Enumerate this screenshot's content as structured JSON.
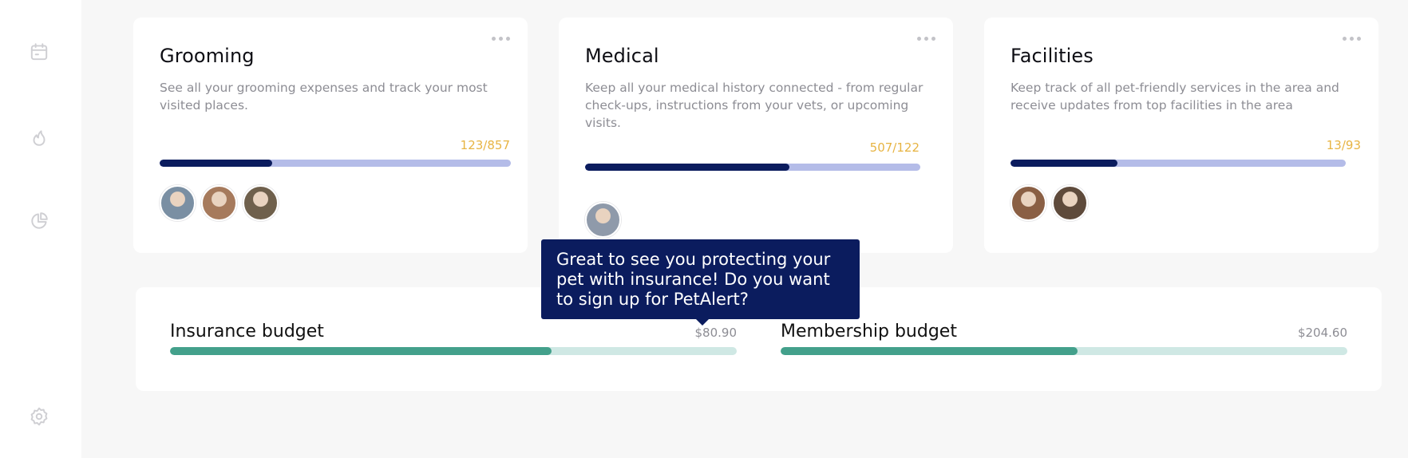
{
  "sidebar": {
    "items": [
      {
        "icon": "calendar-icon"
      },
      {
        "icon": "flame-icon"
      },
      {
        "icon": "pie-chart-icon"
      },
      {
        "icon": "gear-icon"
      }
    ]
  },
  "cards": [
    {
      "title": "Grooming",
      "description": "See all your grooming expenses and track your most visited places.",
      "count": "123/857",
      "progress": 0.32,
      "avatars": [
        {
          "tone": "#7a8fa3"
        },
        {
          "tone": "#a67a5c"
        },
        {
          "tone": "#6f604c"
        }
      ]
    },
    {
      "title": "Medical",
      "description": "Keep all your medical history connected - from regular check-ups, instructions from your vets, or upcoming visits.",
      "count": "507/122",
      "progress": 0.61,
      "avatars": [
        {
          "tone": "#8f9aaa"
        }
      ]
    },
    {
      "title": "Facilities",
      "description": "Keep track of all pet-friendly services in the area and receive updates from top facilities in the area",
      "count": "13/93",
      "progress": 0.32,
      "avatars": [
        {
          "tone": "#8a5f44"
        },
        {
          "tone": "#5e4a3b"
        }
      ]
    }
  ],
  "budgets": [
    {
      "label": "Insurance budget",
      "amount": "$80.90",
      "progress": 0.673
    },
    {
      "label": "Membership budget",
      "amount": "$204.60",
      "progress": 0.524
    }
  ],
  "tooltip": {
    "text": "Great to see you protecting your pet with insurance!  Do you want to sign up for PetAlert?"
  },
  "colors": {
    "accent_navy": "#0b1c5e",
    "track_lavender": "#b4bce8",
    "count_gold": "#e7b443",
    "budget_green": "#43a08b",
    "budget_track": "#cfe8e4"
  }
}
